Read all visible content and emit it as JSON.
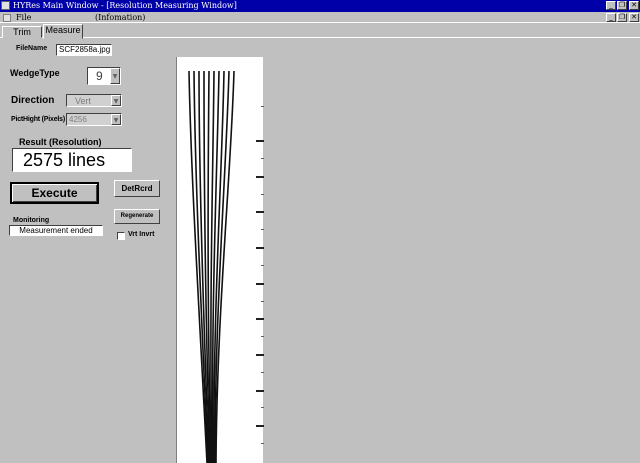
{
  "window": {
    "title": "HYRes Main Window - [Resolution Measuring Window]",
    "minimize_glyph": "_",
    "restore_glyph": "❐",
    "close_glyph": "✕"
  },
  "menu": {
    "file": "File",
    "information": "(Infomation)"
  },
  "tabs": [
    {
      "label": "Trim"
    },
    {
      "label": "Measure"
    }
  ],
  "form": {
    "filename_label": "FileName",
    "filename_value": "SCF2858a.jpg",
    "wedge_label": "WedgeType",
    "wedge_value": "9",
    "direction_label": "Direction",
    "direction_value": "Vert",
    "pict_height_label": "PictHight (Pixels)",
    "pict_height_value": "4256",
    "result_label": "Result (Resolution)",
    "result_value": "2575 lines",
    "execute_label": "Execute",
    "detrcrd_label": "DetRcrd",
    "regenerate_label": "Regenerate",
    "monitoring_label": "Monitoring",
    "monitoring_value": "Measurement ended",
    "vrt_invrt_label": "Vrt Invrt",
    "vrt_invrt_checked": false,
    "dropdown_glyph": "▼"
  }
}
